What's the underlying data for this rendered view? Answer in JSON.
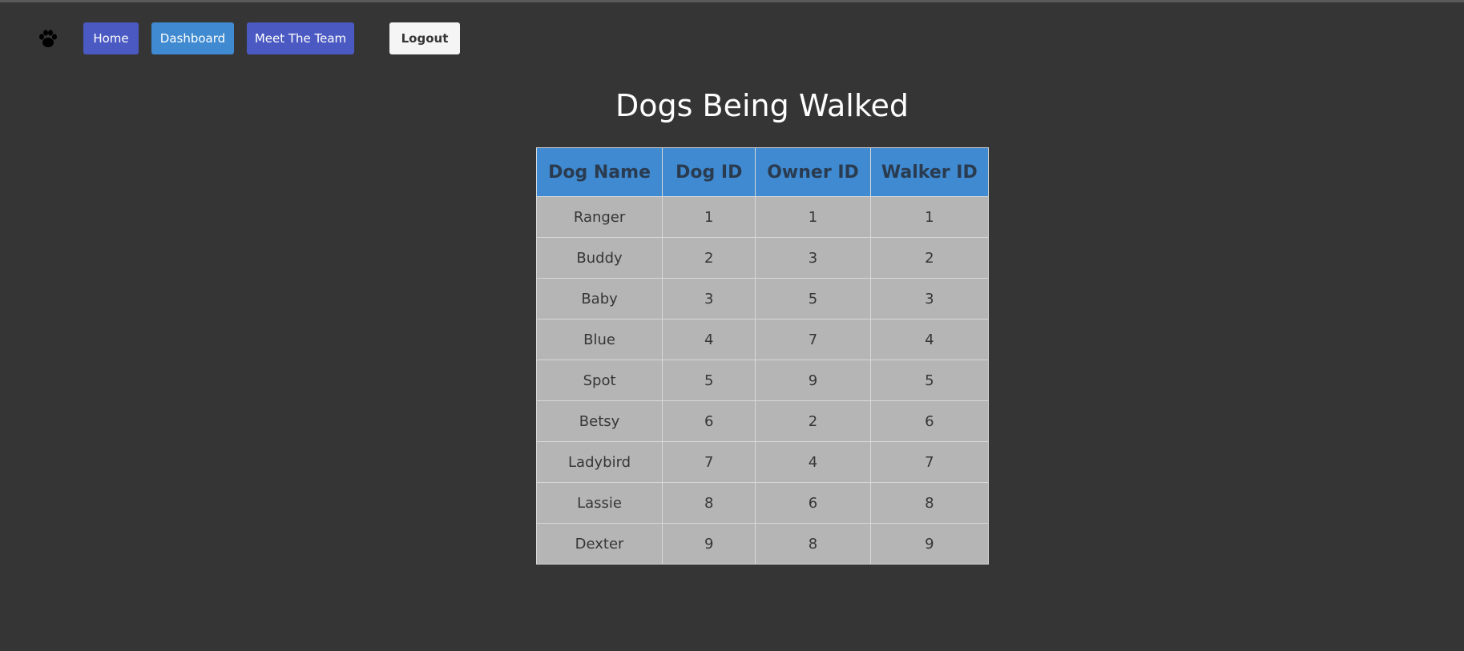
{
  "nav": {
    "logo_icon": "paw-icon",
    "home_label": "Home",
    "dashboard_label": "Dashboard",
    "team_label": "Meet The Team",
    "logout_label": "Logout"
  },
  "colors": {
    "background": "#353535",
    "primary": "#4b5ac2",
    "info": "#3f8ad0",
    "table_row": "#b5b5b5"
  },
  "main": {
    "title": "Dogs Being Walked"
  },
  "table": {
    "headers": [
      "Dog Name",
      "Dog ID",
      "Owner ID",
      "Walker ID"
    ],
    "rows": [
      [
        "Ranger",
        "1",
        "1",
        "1"
      ],
      [
        "Buddy",
        "2",
        "3",
        "2"
      ],
      [
        "Baby",
        "3",
        "5",
        "3"
      ],
      [
        "Blue",
        "4",
        "7",
        "4"
      ],
      [
        "Spot",
        "5",
        "9",
        "5"
      ],
      [
        "Betsy",
        "6",
        "2",
        "6"
      ],
      [
        "Ladybird",
        "7",
        "4",
        "7"
      ],
      [
        "Lassie",
        "8",
        "6",
        "8"
      ],
      [
        "Dexter",
        "9",
        "8",
        "9"
      ]
    ]
  }
}
